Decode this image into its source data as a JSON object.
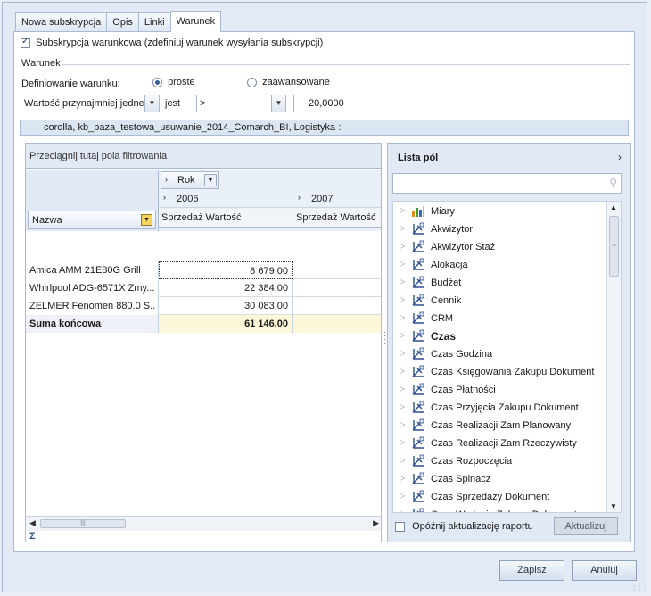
{
  "tabs": [
    "Nowa subskrypcja",
    "Opis",
    "Linki",
    "Warunek"
  ],
  "subscription_checkbox_label": "Subskrypcja warunkowa (zdefiniuj warunek wysyłania subskrypcji)",
  "group_title": "Warunek",
  "definition_label": "Definiowanie warunku:",
  "radio_simple": "proste",
  "radio_advanced": "zaawansowane",
  "condition": {
    "field_combo": "Wartość przynajmniej jedne",
    "jest_label": "jest",
    "operator_combo": ">",
    "value": "20,0000"
  },
  "info_bar": "corolla, kb_baza_testowa_usuwanie_2014_Comarch_BI, Logistyka :",
  "pivot": {
    "filter_area_label": "Przeciągnij tutaj pola filtrowania",
    "column_field": "Rok",
    "years": [
      "2006",
      "2007"
    ],
    "measure": "Sprzedaż Wartość",
    "row_field": "Nazwa",
    "rows": [
      {
        "name": "Amica AMM 21E80G Grill",
        "v2006": "8 679,00"
      },
      {
        "name": "Whirlpool ADG-6571X Zmy...",
        "v2006": "22 384,00"
      },
      {
        "name": "ZELMER Fenomen 880.0 S...",
        "v2006": "30 083,00"
      }
    ],
    "total": {
      "name": "Suma końcowa",
      "v2006": "61 146,00"
    }
  },
  "field_list": {
    "title": "Lista pól",
    "search_placeholder": "",
    "items": [
      {
        "label": "Miary",
        "icon": "measures-icon",
        "bold": false
      },
      {
        "label": "Akwizytor",
        "icon": "dimension-icon",
        "bold": false
      },
      {
        "label": "Akwizytor Staż",
        "icon": "dimension-icon",
        "bold": false
      },
      {
        "label": "Alokacja",
        "icon": "dimension-icon",
        "bold": false
      },
      {
        "label": "Budżet",
        "icon": "dimension-icon",
        "bold": false
      },
      {
        "label": "Cennik",
        "icon": "dimension-icon",
        "bold": false
      },
      {
        "label": "CRM",
        "icon": "dimension-icon",
        "bold": false
      },
      {
        "label": "Czas",
        "icon": "dimension-icon",
        "bold": true
      },
      {
        "label": "Czas Godzina",
        "icon": "dimension-icon",
        "bold": false
      },
      {
        "label": "Czas Księgowania Zakupu Dokument",
        "icon": "dimension-icon",
        "bold": false
      },
      {
        "label": "Czas Płatności",
        "icon": "dimension-icon",
        "bold": false
      },
      {
        "label": "Czas Przyjęcia Zakupu Dokument",
        "icon": "dimension-icon",
        "bold": false
      },
      {
        "label": "Czas Realizacji Zam Planowany",
        "icon": "dimension-icon",
        "bold": false
      },
      {
        "label": "Czas Realizacji Zam Rzeczywisty",
        "icon": "dimension-icon",
        "bold": false
      },
      {
        "label": "Czas Rozpoczęcia",
        "icon": "dimension-icon",
        "bold": false
      },
      {
        "label": "Czas Spinacz",
        "icon": "dimension-icon",
        "bold": false
      },
      {
        "label": "Czas Sprzedaży Dokument",
        "icon": "dimension-icon",
        "bold": false
      },
      {
        "label": "Czas Wydania Zakupu Dokument",
        "icon": "dimension-icon",
        "bold": false
      }
    ],
    "defer_label": "Opóźnij aktualizację raportu",
    "update_button": "Aktualizuj"
  },
  "buttons": {
    "save": "Zapisz",
    "cancel": "Anuluj"
  }
}
